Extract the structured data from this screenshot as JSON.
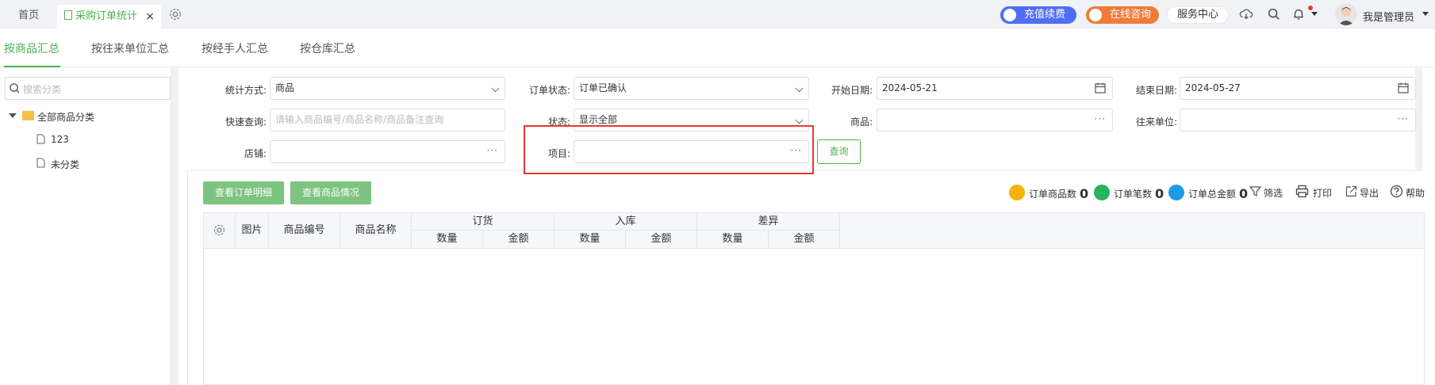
{
  "tabs": {
    "home": "首页",
    "active": "采购订单统计",
    "close": "×"
  },
  "header": {
    "recharge": "充值续费",
    "consult": "在线咨询",
    "service": "服务中心",
    "user": "我是管理员"
  },
  "subnav": [
    {
      "label": "按商品汇总"
    },
    {
      "label": "按往来单位汇总"
    },
    {
      "label": "按经手人汇总"
    },
    {
      "label": "按仓库汇总"
    }
  ],
  "sidebar": {
    "search_placeholder": "搜索分类",
    "root": "全部商品分类",
    "children": [
      "123",
      "未分类"
    ]
  },
  "form": {
    "stat_mode_label": "统计方式:",
    "stat_mode_value": "商品",
    "order_status_label": "订单状态:",
    "order_status_value": "订单已确认",
    "start_date_label": "开始日期:",
    "start_date_value": "2024-05-21",
    "end_date_label": "结束日期:",
    "end_date_value": "2024-05-27",
    "quick_query_label": "快速查询:",
    "quick_query_placeholder": "请输入商品编号/商品名称/商品备注查询",
    "status_label": "状态:",
    "status_value": "显示全部",
    "product_label": "商品:",
    "partner_label": "往来单位:",
    "store_label": "店铺:",
    "project_label": "项目:",
    "query_button": "查询"
  },
  "actions": {
    "view_detail": "查看订单明细",
    "view_product": "查看商品情况"
  },
  "stats": {
    "product_count_label": "订单商品数",
    "product_count": "0",
    "order_count_label": "订单笔数",
    "order_count": "0",
    "total_amount_label": "订单总金额",
    "total_amount": "0"
  },
  "tools": {
    "filter": "筛选",
    "print": "打印",
    "export": "导出",
    "help": "帮助"
  },
  "table": {
    "image": "图片",
    "code": "商品编号",
    "name": "商品名称",
    "groups": [
      {
        "label": "订货",
        "qty": "数量",
        "amount": "金额"
      },
      {
        "label": "入库",
        "qty": "数量",
        "amount": "金额"
      },
      {
        "label": "差异",
        "qty": "数量",
        "amount": "金额"
      }
    ]
  },
  "colors": {
    "accent": "#4caf50",
    "recharge": "#4e6ef2",
    "consult": "#f07c3a",
    "highlight_box": "#e53935"
  }
}
